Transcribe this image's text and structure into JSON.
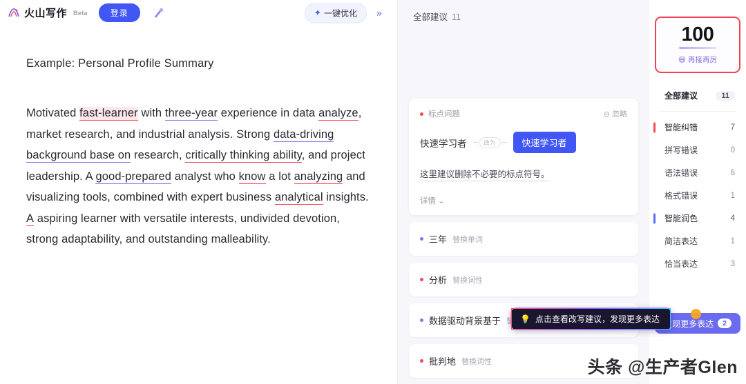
{
  "header": {
    "logo_text": "火山写作",
    "beta_badge": "Beta",
    "login_label": "登录",
    "magic_icon": "magic-wand-icon",
    "optimize_label": "一键优化",
    "optimize_icon": "sparkle-icon",
    "collapse_icon": "double-chevron-right-icon"
  },
  "editor": {
    "title": "Example: Personal Profile Summary",
    "paragraph": {
      "p1": "Motivated ",
      "w_fast_learner": "fast-learner",
      "p2": " with ",
      "w_three_year": "three-year",
      "p3": " experience in data ",
      "w_analyze": "analyze",
      "p4": ", market research, and industrial analysis. Strong ",
      "w_data_driving": "data-driving background base on",
      "p5": " research, ",
      "w_critically": "critically thinking ability",
      "p6": ", and project leadership. A ",
      "w_good_prepared": "good-prepared",
      "p7": " analyst who ",
      "w_know": "know",
      "p8": " a lot ",
      "w_analyzing": "analyzing",
      "p9": " and visualizing tools, combined with expert business ",
      "w_analytical": "analytical",
      "p10": " insights. ",
      "w_a": "A",
      "p11": " aspiring learner with versatile interests, undivided devotion, strong adaptability, and outstanding malleability."
    }
  },
  "suggestions": {
    "header_label": "全部建议",
    "header_count": "11",
    "card": {
      "type_label": "标点问题",
      "type_dot_color": "#f04a5a",
      "ignore_label": "忽略",
      "ignore_icon": "minus-circle-icon",
      "original_word": "快速学习者",
      "arrow_pill_label": "改为",
      "replacement_word": "快速学习者",
      "note": "这里建议删除不必要的标点符号。",
      "more_label": "详情",
      "more_icon": "chevron-down-icon"
    },
    "rows": [
      {
        "word": "三年",
        "action": "替换单词",
        "dot_color": "#7b79f0"
      },
      {
        "word": "分析",
        "action": "替换词性",
        "dot_color": "#f04a5a"
      },
      {
        "word": "数据驱动背景基于",
        "action": "替换单词",
        "dot_color": "#7b79f0"
      },
      {
        "word": "批判地",
        "action": "替换词性",
        "dot_color": "#f04a5a"
      }
    ]
  },
  "sidebar": {
    "score": {
      "value": "100",
      "emoji": "😄",
      "label": "再接再厉",
      "border_color": "#f0434f"
    },
    "all_item": {
      "label": "全部建议",
      "count": "11"
    },
    "groups": [
      {
        "label": "智能纠错",
        "count": "7",
        "bar_color": "#f04a5a",
        "children": [
          {
            "label": "拼写错误",
            "count": "0"
          },
          {
            "label": "语法错误",
            "count": "6"
          },
          {
            "label": "格式错误",
            "count": "1"
          }
        ]
      },
      {
        "label": "智能润色",
        "count": "4",
        "bar_color": "#5b6cf7",
        "children": [
          {
            "label": "简洁表达",
            "count": "1"
          },
          {
            "label": "恰当表达",
            "count": "3"
          }
        ]
      }
    ],
    "more_button": {
      "label": "发现更多表达",
      "count": "2"
    }
  },
  "overlays": {
    "tooltip": {
      "icon": "lightbulb-icon",
      "text": "点击查看改写建议，发现更多表达"
    },
    "watermark": "头条 @生产者Glen"
  }
}
